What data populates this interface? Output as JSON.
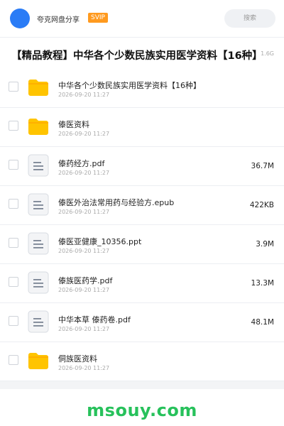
{
  "header": {
    "app_name": "夸克网盘分享",
    "badge": "SVIP",
    "search_placeholder": "搜索"
  },
  "folder": {
    "title": "【精品教程】中华各个少数民族实用医学资料【16种】",
    "size": "1.6G"
  },
  "files": [
    {
      "name": "中华各个少数民族实用医学资料【16种】",
      "date": "2026-09-20 11:27",
      "size": "",
      "type": "folder"
    },
    {
      "name": "傣医资料",
      "date": "2026-09-20 11:27",
      "size": "",
      "type": "folder"
    },
    {
      "name": "傣药经方.pdf",
      "date": "2026-09-20 11:27",
      "size": "36.7M",
      "type": "file"
    },
    {
      "name": "傣医外治法常用药与经验方.epub",
      "date": "2026-09-20 11:27",
      "size": "422KB",
      "type": "file"
    },
    {
      "name": "傣医亚健康_10356.ppt",
      "date": "2026-09-20 11:27",
      "size": "3.9M",
      "type": "file"
    },
    {
      "name": "傣族医药学.pdf",
      "date": "2026-09-20 11:27",
      "size": "13.3M",
      "type": "file"
    },
    {
      "name": "中华本草 傣药卷.pdf",
      "date": "2026-09-20 11:27",
      "size": "48.1M",
      "type": "file"
    },
    {
      "name": "侗族医资料",
      "date": "2026-09-20 11:27",
      "size": "",
      "type": "folder"
    }
  ],
  "watermark": "msouy.com",
  "colors": {
    "accent": "#2a7cf6",
    "svip": "#ff9a1f",
    "folder": "#ffc400",
    "watermark": "#27c15b"
  }
}
